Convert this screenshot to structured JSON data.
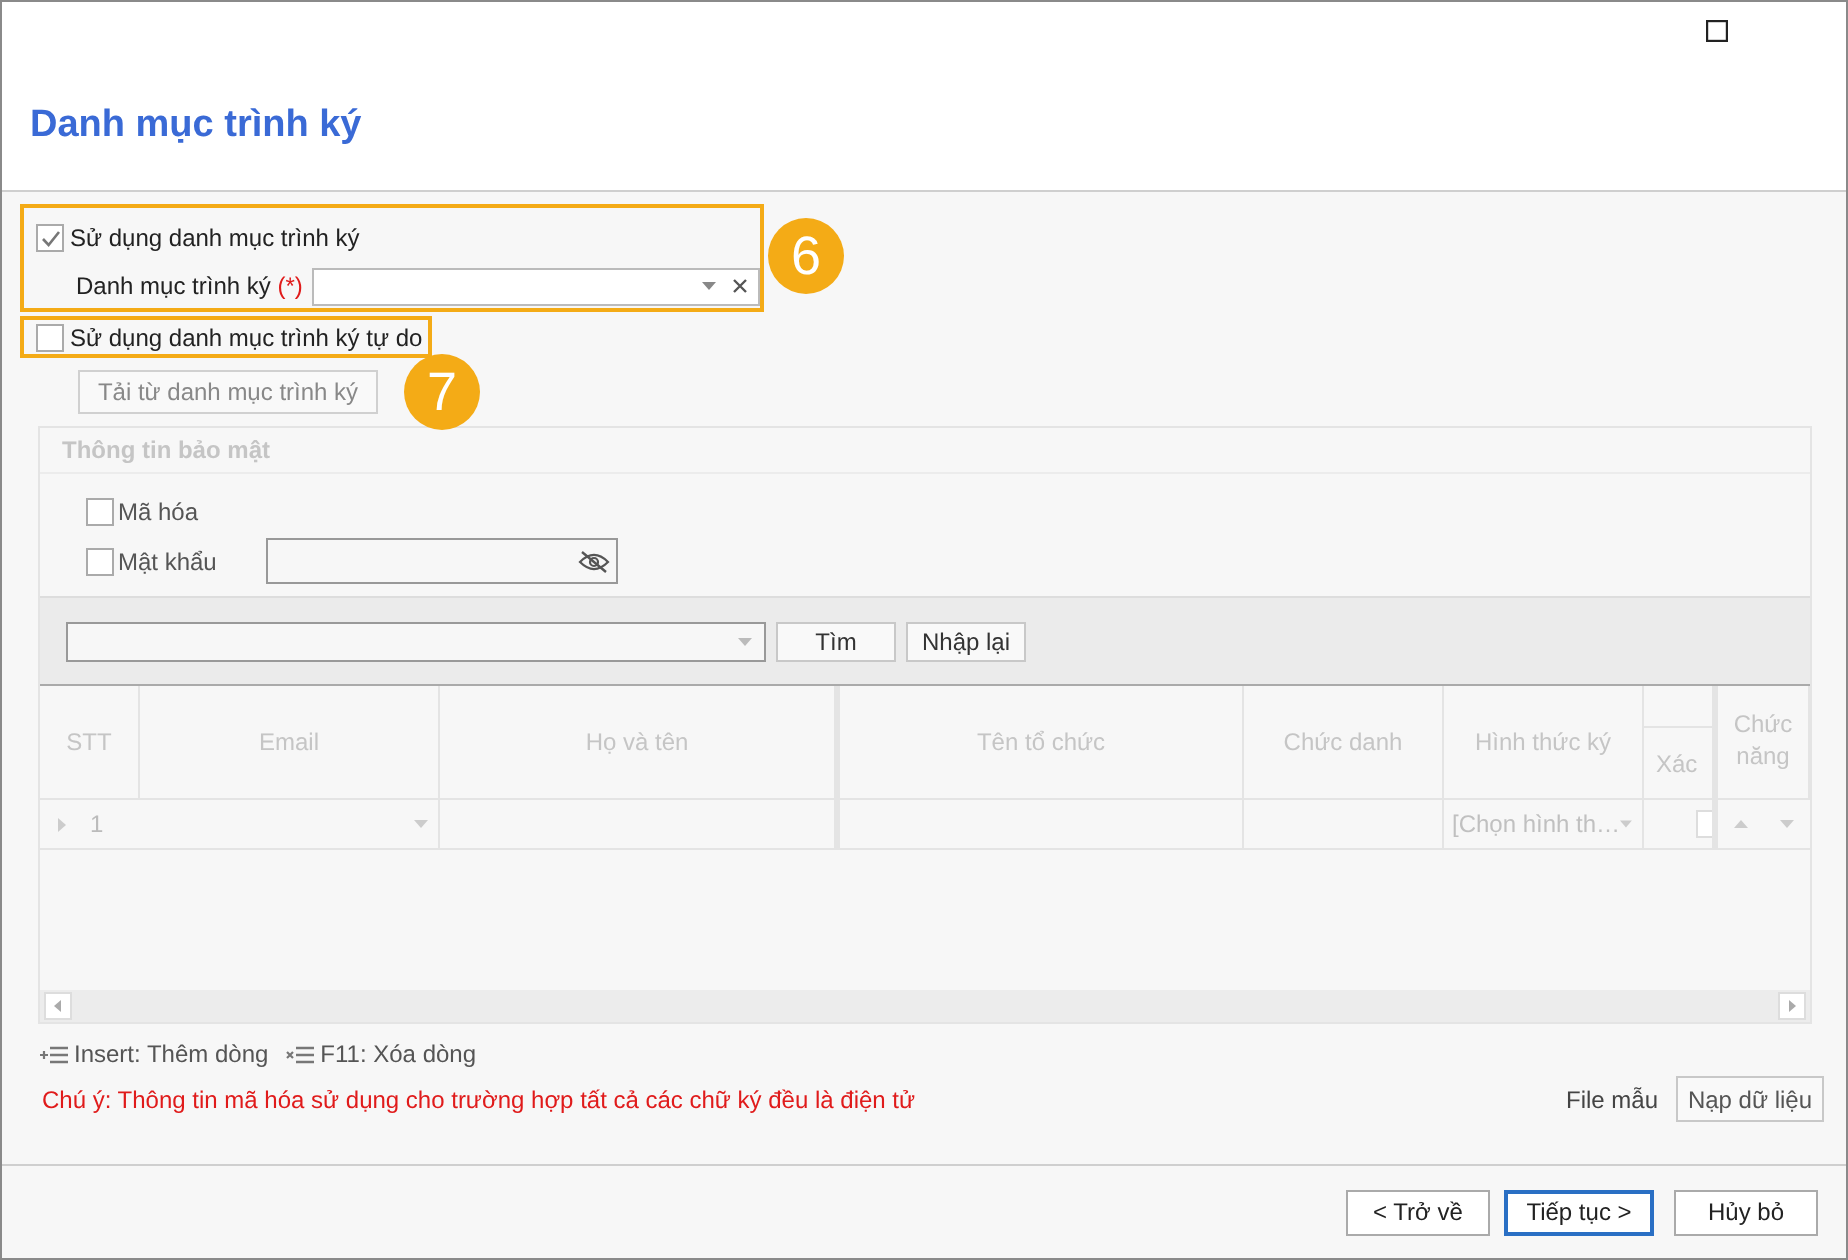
{
  "window": {
    "title": "Danh mục trình ký"
  },
  "sign_list": {
    "checkbox": {
      "label": "Sử dụng danh mục trình ký",
      "checked": true
    },
    "field": {
      "label": "Danh mục trình ký",
      "required_mark": "(*)"
    },
    "callout": "6"
  },
  "free_sign_list": {
    "checkbox": {
      "label": "Sử dụng danh mục trình ký tự do",
      "checked": false
    },
    "callout": "7",
    "load_button": {
      "label": "Tải từ danh mục trình ký",
      "disabled": true
    }
  },
  "security": {
    "title": "Thông tin bảo mật",
    "disabled": true,
    "options": [
      {
        "label": "Mã hóa",
        "checked": false
      },
      {
        "label": "Mật khẩu",
        "checked": false
      }
    ]
  },
  "search": {
    "find_button": "Tìm",
    "reset_button": "Nhập lại"
  },
  "table": {
    "columns": [
      "STT",
      "Email",
      "Họ và tên",
      "Tên tổ chức",
      "Chức danh",
      "Hình thức ký"
    ],
    "column_7": {
      "sub_label": "Xác"
    },
    "actions_column": "Chức năng",
    "rows": [
      {
        "stt": "1",
        "signing_method": "[Chọn hình th…",
        "confirm_checked": false
      }
    ]
  },
  "shortcuts": [
    "Insert: Thêm dòng",
    "F11: Xóa dòng"
  ],
  "note": "Chú ý: Thông tin mã hóa sử dụng cho trường hợp tất cả các chữ ký đều là điện tử",
  "template_link": "File mẫu",
  "load_data_button": "Nạp dữ liệu",
  "footer_buttons": [
    {
      "label": "< Trở về",
      "selected": false
    },
    {
      "label": "Tiếp tục >",
      "selected": true
    },
    {
      "label": "Hủy bỏ",
      "selected": false
    }
  ]
}
